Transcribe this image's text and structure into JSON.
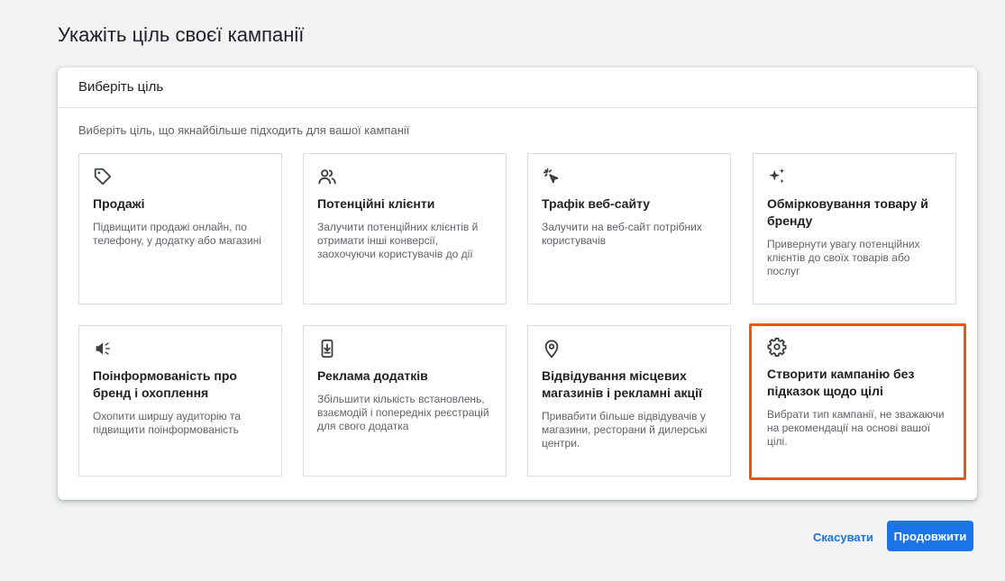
{
  "page": {
    "title": "Укажіть ціль своєї кампанії"
  },
  "panel": {
    "header": "Виберіть ціль",
    "subtitle": "Виберіть ціль, що якнайбільше підходить для вашої кампанії"
  },
  "goals": [
    {
      "icon": "tag-icon",
      "title": "Продажі",
      "description": "Підвищити продажі онлайн, по телефону, у додатку або магазині"
    },
    {
      "icon": "people-icon",
      "title": "Потенційні клієнти",
      "description": "Залучити потенційних клієнтів й отримати інші конверсії, заохочуючи користувачів до дії"
    },
    {
      "icon": "cursor-click-icon",
      "title": "Трафік веб-сайту",
      "description": "Залучити на веб-сайт потрібних користувачів"
    },
    {
      "icon": "sparkle-icon",
      "title": "Обмірковування товару й бренду",
      "description": "Привернути увагу потенційних клієнтів до своїх товарів або послуг"
    },
    {
      "icon": "megaphone-icon",
      "title": "Поінформованість про бренд і охоплення",
      "description": "Охопити ширшу аудиторію та підвищити поінформованість"
    },
    {
      "icon": "phone-download-icon",
      "title": "Реклама додатків",
      "description": "Збільшити кількість встановлень, взаємодій і попередніх реєстрацій для свого додатка"
    },
    {
      "icon": "location-pin-icon",
      "title": "Відвідування місцевих магазинів і рекламні акції",
      "description": "Привабити більше відвідувачів у магазини, ресторани й дилерські центри."
    },
    {
      "icon": "gear-icon",
      "title": "Створити кампанію без підказок щодо цілі",
      "description": "Вибрати тип кампанії, не зважаючи на рекомендації на основі вашої цілі."
    }
  ],
  "selected_goal": "Створити кампанію без підказок щодо цілі",
  "actions": {
    "cancel_label": "Скасувати",
    "continue_label": "Продовжити"
  },
  "colors": {
    "accent": "#1a73e8",
    "selection_outline": "#e8590c",
    "background": "#f1f3f4"
  }
}
